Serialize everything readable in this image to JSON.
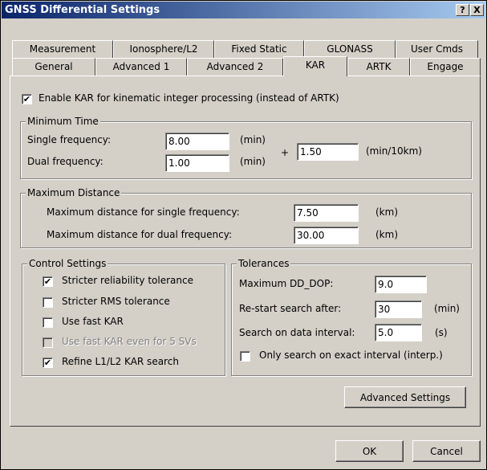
{
  "window": {
    "title": "GNSS Differential Settings",
    "help_btn": "?",
    "close_btn": "X"
  },
  "tabs_row1": [
    "Measurement",
    "Ionosphere/L2",
    "Fixed Static",
    "GLONASS",
    "User Cmds"
  ],
  "tabs_row2": [
    "General",
    "Advanced 1",
    "Advanced 2",
    "KAR",
    "ARTK",
    "Engage"
  ],
  "active_tab": "KAR",
  "enable_kar": {
    "label": "Enable KAR for kinematic integer processing (instead of ARTK)",
    "checked": true
  },
  "minimum_time": {
    "legend": "Minimum Time",
    "single_label": "Single frequency:",
    "single_value": "8.00",
    "single_unit": "(min)",
    "dual_label": "Dual frequency:",
    "dual_value": "1.00",
    "dual_unit": "(min)",
    "plus": "+",
    "per_dist_value": "1.50",
    "per_dist_unit": "(min/10km)"
  },
  "maximum_distance": {
    "legend": "Maximum Distance",
    "single_label": "Maximum distance for single frequency:",
    "single_value": "7.50",
    "single_unit": "(km)",
    "dual_label": "Maximum distance for dual frequency:",
    "dual_value": "30.00",
    "dual_unit": "(km)"
  },
  "control_settings": {
    "legend": "Control Settings",
    "items": [
      {
        "label": "Stricter reliability tolerance",
        "checked": true,
        "enabled": true
      },
      {
        "label": "Stricter RMS tolerance",
        "checked": false,
        "enabled": true
      },
      {
        "label": "Use fast KAR",
        "checked": false,
        "enabled": true
      },
      {
        "label": "Use fast KAR even for 5 SVs",
        "checked": false,
        "enabled": false
      },
      {
        "label": "Refine L1/L2 KAR search",
        "checked": true,
        "enabled": true
      }
    ]
  },
  "tolerances": {
    "legend": "Tolerances",
    "dd_dop_label": "Maximum DD_DOP:",
    "dd_dop_value": "9.0",
    "restart_label": "Re-start search after:",
    "restart_value": "30",
    "restart_unit": "(min)",
    "interval_label": "Search on data interval:",
    "interval_value": "5.0",
    "interval_unit": "(s)",
    "exact_label": "Only search on exact interval (interp.)",
    "exact_checked": false
  },
  "buttons": {
    "advanced": "Advanced Settings",
    "ok": "OK",
    "cancel": "Cancel"
  },
  "colors": {
    "face": "#d4d0c8",
    "title_start": "#0a246a",
    "title_end": "#a6caf0"
  }
}
